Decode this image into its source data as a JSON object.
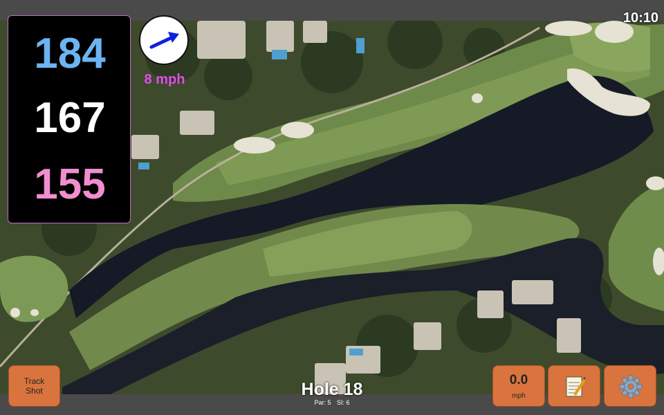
{
  "clock": "10:10",
  "distances": {
    "back": "184",
    "middle": "167",
    "front": "155",
    "colors": {
      "back": "#6cb4f2",
      "middle": "#ffffff",
      "front": "#f08ed0"
    }
  },
  "wind": {
    "speed_label": "8 mph",
    "icon": "wind-direction-arrow-icon",
    "arrow_color": "#1020e0",
    "label_color": "#e050e8"
  },
  "hole": {
    "title": "Hole 18",
    "par": "Par: 5",
    "si": "SI: 6"
  },
  "buttons": {
    "track_shot_line1": "Track",
    "track_shot_line2": "Shot",
    "wind_value": "0.0",
    "wind_unit": "mph",
    "notes_icon": "notepad-icon",
    "settings_icon": "gear-icon",
    "color": "#d9743e"
  }
}
